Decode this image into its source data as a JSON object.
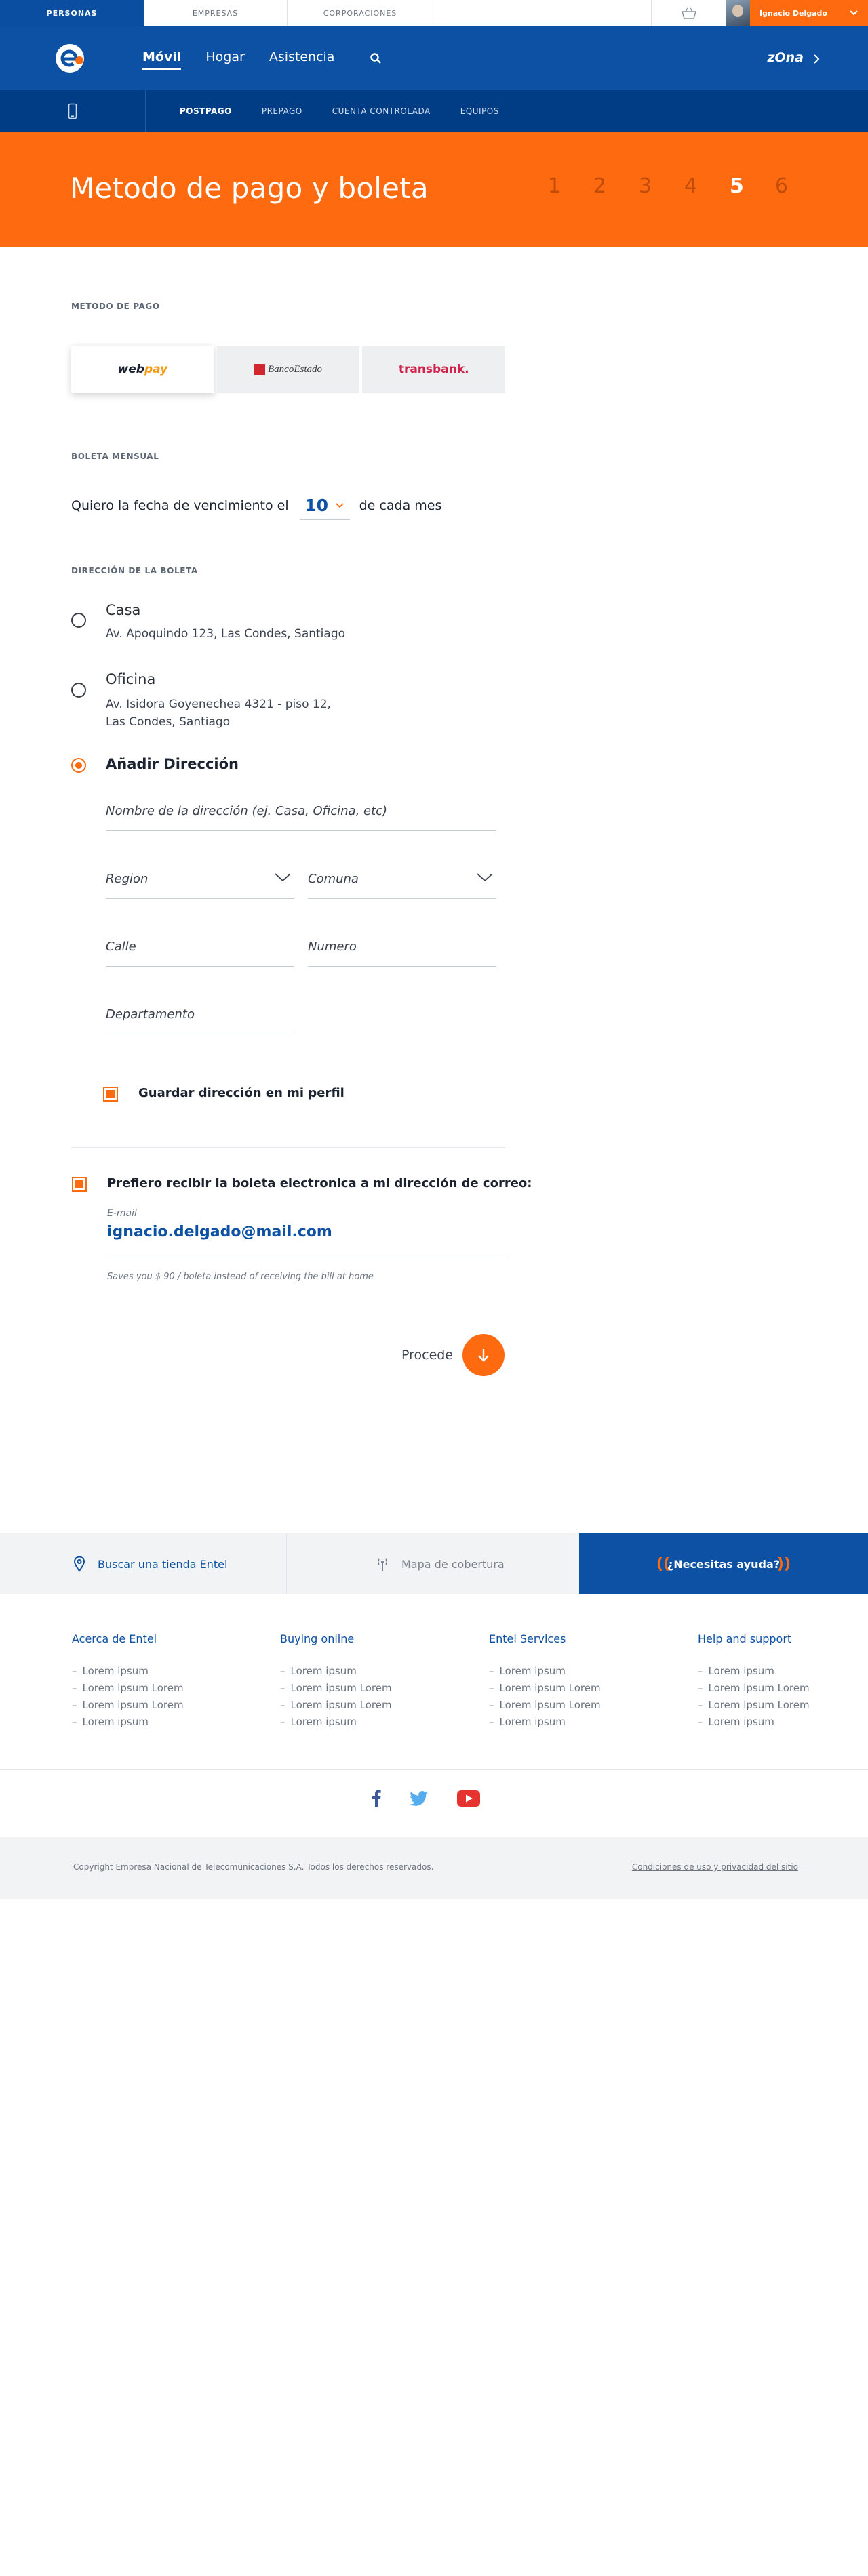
{
  "topbar": {
    "tabs": [
      "PERSONAS",
      "EMPRESAS",
      "CORPORACIONES"
    ],
    "user_name": "Ignacio Delgado"
  },
  "nav": {
    "links": [
      "Móvil",
      "Hogar",
      "Asistencia"
    ],
    "zona": "zOna"
  },
  "subnav": {
    "items": [
      "POSTPAGO",
      "PREPAGO",
      "CUENTA CONTROLADA",
      "EQUIPOS"
    ]
  },
  "banner": {
    "title": "Metodo de pago y boleta",
    "steps": [
      "1",
      "2",
      "3",
      "4",
      "5",
      "6"
    ],
    "active_step": "5"
  },
  "payment": {
    "label": "METODO DE PAGO",
    "options": [
      {
        "name": "webpay",
        "part1": "web",
        "part2": "pay"
      },
      {
        "name": "BancoEstado",
        "text": "BancoEstado"
      },
      {
        "name": "transbank",
        "text": "transbank."
      }
    ]
  },
  "boleta": {
    "label": "BOLETA MENSUAL",
    "sentence_before": "Quiero la fecha de vencimiento el",
    "day": "10",
    "sentence_after": "de cada mes"
  },
  "address": {
    "label": "DIRECCIÓN DE LA BOLETA",
    "options": [
      {
        "name": "Casa",
        "line1": "Av. Apoquindo 123, Las Condes, Santiago",
        "line2": ""
      },
      {
        "name": "Oficina",
        "line1": "Av. Isidora Goyenechea 4321 - piso 12,",
        "line2": "Las Condes, Santiago"
      }
    ],
    "add_label": "Añadir Dirección",
    "form": {
      "name_placeholder": "Nombre de la dirección (ej. Casa, Oficina, etc)",
      "region": "Region",
      "comuna": "Comuna",
      "calle": "Calle",
      "numero": "Numero",
      "departamento": "Departamento"
    },
    "save_label": "Guardar dirección en mi perfil"
  },
  "electronic": {
    "label": "Prefiero recibir la boleta electronica a mi dirección de correo:",
    "email_label": "E-mail",
    "email": "ignacio.delgado@mail.com",
    "note": "Saves you $ 90 / boleta instead of receiving the bill at home"
  },
  "proceed": {
    "label": "Procede"
  },
  "footer": {
    "store": "Buscar una tienda Entel",
    "map": "Mapa de cobertura",
    "help": "¿Necesitas ayuda?",
    "columns": [
      {
        "title": "Acerca de Entel",
        "items": [
          "Lorem ipsum",
          "Lorem ipsum Lorem",
          "Lorem ipsum Lorem",
          "Lorem ipsum"
        ]
      },
      {
        "title": "Buying online",
        "items": [
          "Lorem ipsum",
          "Lorem ipsum Lorem",
          "Lorem ipsum Lorem",
          "Lorem ipsum"
        ]
      },
      {
        "title": "Entel Services",
        "items": [
          "Lorem ipsum",
          "Lorem ipsum Lorem",
          "Lorem ipsum Lorem",
          "Lorem ipsum"
        ]
      },
      {
        "title": "Help and support",
        "items": [
          "Lorem ipsum",
          "Lorem ipsum Lorem",
          "Lorem ipsum Lorem",
          "Lorem ipsum"
        ]
      }
    ],
    "copyright": "Copyright Empresa Nacional de Telecomunicaciones S.A. Todos los derechos reservados.",
    "terms": "Condiciones de uso y privacidad del sitio"
  },
  "colors": {
    "brand_blue": "#0c51a3",
    "brand_orange": "#fe6a10"
  }
}
